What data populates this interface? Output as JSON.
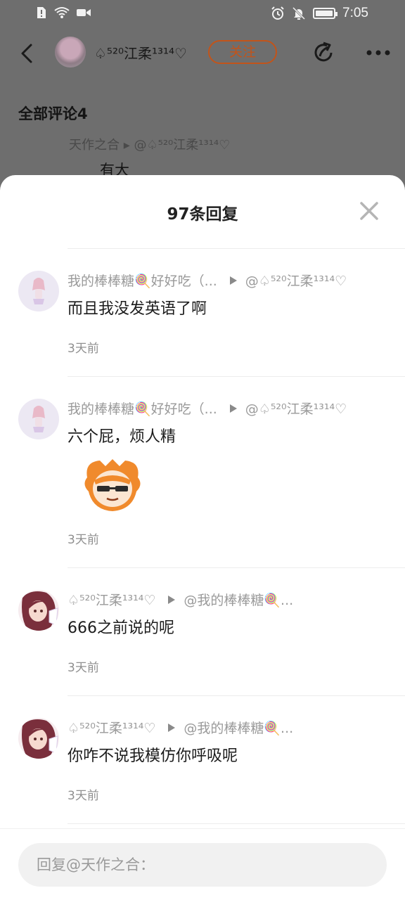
{
  "status_bar": {
    "time": "7:05",
    "icons": [
      "sim-alert-icon",
      "wifi-icon",
      "video-icon",
      "alarm-icon",
      "mute-bell-icon",
      "battery-icon"
    ]
  },
  "header": {
    "user_name": "♤⁵²⁰江柔¹³¹⁴♡",
    "follow_label": "关注",
    "accent_color": "#c2541a"
  },
  "comments_section": {
    "title": "全部评论4",
    "peek_meta": "天作之合  ▸ @♤⁵²⁰江柔¹³¹⁴♡",
    "peek_text": "有大"
  },
  "sheet": {
    "title": "97条回复"
  },
  "replies": [
    {
      "author": "我的棒棒糖🍭好好吃（...",
      "target": "@♤⁵²⁰江柔¹³¹⁴♡",
      "text": "而且我没发英语了啊",
      "time": "3天前",
      "has_sticker": false
    },
    {
      "author": "我的棒棒糖🍭好好吃（...",
      "target": "@♤⁵²⁰江柔¹³¹⁴♡",
      "text": "六个屁，烦人精",
      "time": "3天前",
      "has_sticker": true
    },
    {
      "author": "♤⁵²⁰江柔¹³¹⁴♡",
      "target": "@我的棒棒糖🍭...",
      "text": "666之前说的呢",
      "time": "3天前",
      "has_sticker": false
    },
    {
      "author": "♤⁵²⁰江柔¹³¹⁴♡",
      "target": "@我的棒棒糖🍭...",
      "text": "你咋不说我模仿你呼吸呢",
      "time": "3天前",
      "has_sticker": false
    }
  ],
  "input": {
    "placeholder": "回复@天作之合："
  }
}
